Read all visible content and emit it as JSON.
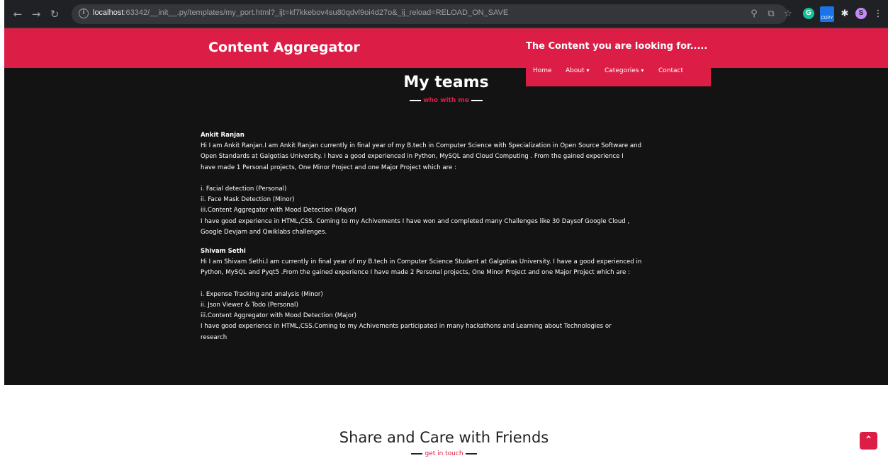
{
  "browser": {
    "url_host": "localhost",
    "url_rest": ":63342/__init__.py/templates/my_port.html?_ijt=kf7kkebov4su80qdvl9oi4d27o&_ij_reload=RELOAD_ON_SAVE",
    "icons": [
      "back-arrow",
      "forward-arrow",
      "reload",
      "info",
      "zoom",
      "share",
      "bookmark-star",
      "grammarly",
      "copy-extension",
      "puzzle-extensions",
      "profile",
      "kebab-menu"
    ],
    "ext_copy_label": "COPY",
    "profile_initial": "S",
    "grammarly_initial": "G"
  },
  "header": {
    "logo": "Content Aggregator",
    "tagline": "The Content you are looking for.....",
    "nav": {
      "home": "Home",
      "about": "About",
      "categories": "Categories",
      "contact": "Contact"
    },
    "accent": "#dc1e46"
  },
  "teams": {
    "title": "My teams",
    "subtitle": "who with me",
    "members": [
      {
        "name": "Ankit Ranjan",
        "bio": [
          "Hi I am Ankit Ranjan.I am Ankit Ranjan currently in final year of my B.tech in Computer Science with Specialization in Open Source Software and",
          "Open Standards at Galgotias University. I have a good experienced in Python, MySQL and Cloud Computing . From the gained experience I",
          "have made 1 Personal projects, One Minor Project and one Major Project which are :"
        ],
        "projects": [
          "i. Facial detection (Personal)",
          "ii. Face Mask Detection (Minor)",
          "iii.Content Aggregator with Mood Detection (Major)"
        ],
        "experience": [
          "I have good experience in HTML,CSS. Coming to my Achivements I have won and completed many Challenges like 30 Daysof Google Cloud ,",
          "Google Devjam and Qwiklabs challenges."
        ]
      },
      {
        "name": "Shivam Sethi",
        "bio": [
          "Hi I am Shivam Sethi.I am currently in final year of my B.tech in Computer Science Student at Galgotias University. I have a good experienced in",
          "Python, MySQL and Pyqt5 .From the gained experience I have made 2 Personal projects, One Minor Project and one Major Project which are :"
        ],
        "projects": [
          "i. Expense Tracking and analysis (Minor)",
          "ii. Json Viewer & Todo (Personal)",
          "iii.Content Aggregator with Mood Detection (Major)"
        ],
        "experience": [
          "I have good experience in HTML,CSS.Coming to my Achivements participated in many hackathons and Learning about Technologies or",
          "research"
        ]
      }
    ]
  },
  "share": {
    "title": "Share and Care with Friends",
    "subtitle": "get in touch"
  }
}
